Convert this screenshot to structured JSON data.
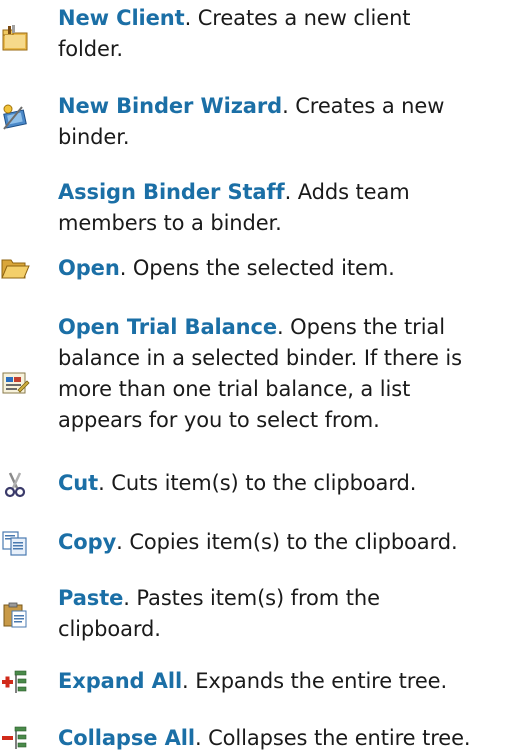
{
  "items": [
    {
      "name": "New Client",
      "icon": "new-client-folder-icon",
      "lines": [
        ". Creates a new client",
        "folder."
      ]
    },
    {
      "name": "New Binder Wizard",
      "icon": "binder-wizard-icon",
      "lines": [
        ". Creates a new",
        "binder."
      ]
    },
    {
      "name": "Assign Binder Staff",
      "icon": "",
      "lines": [
        ". Adds team",
        "members to a binder."
      ]
    },
    {
      "name": "Open",
      "icon": "open-folder-icon",
      "lines": [
        ". Opens the selected item."
      ]
    },
    {
      "name": "Open Trial Balance",
      "icon": "trial-balance-icon",
      "lines": [
        ". Opens the trial",
        "balance in a selected binder. If there is",
        "more than one trial balance, a list",
        "appears for you to select from."
      ]
    },
    {
      "name": "Cut",
      "icon": "scissors-icon",
      "lines": [
        ". Cuts item(s) to the clipboard."
      ]
    },
    {
      "name": "Copy",
      "icon": "copy-icon",
      "lines": [
        ". Copies item(s) to the clipboard."
      ]
    },
    {
      "name": "Paste",
      "icon": "paste-clipboard-icon",
      "lines": [
        ". Pastes item(s) from the",
        "clipboard."
      ]
    },
    {
      "name": "Expand All",
      "icon": "expand-tree-icon",
      "lines": [
        ". Expands the entire tree."
      ]
    },
    {
      "name": "Collapse All",
      "icon": "collapse-tree-icon",
      "lines": [
        ". Collapses the entire tree."
      ]
    }
  ],
  "colors": {
    "command": "#1b6fa6",
    "text": "#1a1a1a"
  }
}
